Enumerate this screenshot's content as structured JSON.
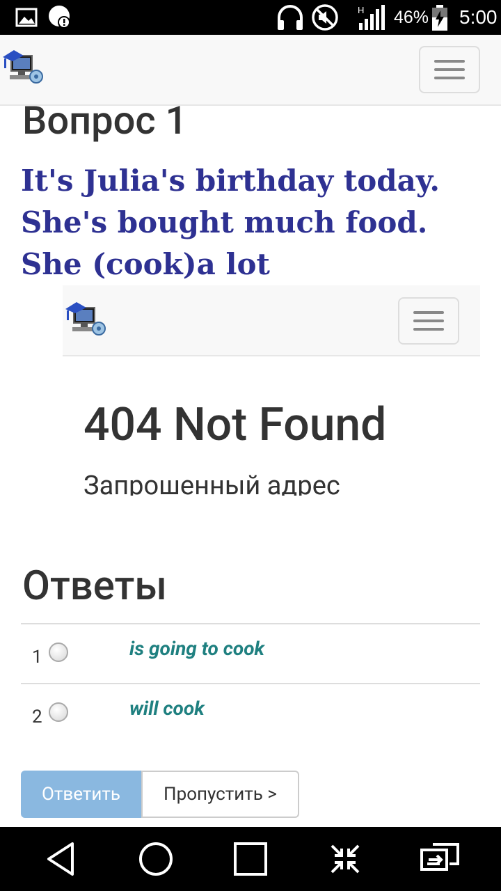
{
  "status_bar": {
    "battery_text": "46%",
    "time": "5:00",
    "icons": [
      "image-icon",
      "alert-icon",
      "headset-icon",
      "mute-icon",
      "signal-icon",
      "battery-charging-icon"
    ]
  },
  "header": {
    "logo_icon": "computer-graduation-logo",
    "menu_icon": "hamburger-icon"
  },
  "question": {
    "title": "Вопрос 1",
    "text": "It's Julia's birthday today. She's bought much food. She (cook)a lot"
  },
  "embedded_frame": {
    "error_title": "404 Not Found",
    "error_text": "Запрошенный адрес"
  },
  "answers": {
    "title": "Ответы",
    "items": [
      {
        "number": "1",
        "text": "is going to cook"
      },
      {
        "number": "2",
        "text": "will cook"
      }
    ]
  },
  "buttons": {
    "answer": "Ответить",
    "skip": "Пропустить >"
  },
  "colors": {
    "question_text": "#2e3192",
    "answer_text": "#1f8080",
    "primary_button": "#8ab8e0"
  },
  "system_nav": {
    "icons": [
      "back-icon",
      "home-icon",
      "recents-icon",
      "shrink-icon",
      "switch-icon"
    ]
  }
}
